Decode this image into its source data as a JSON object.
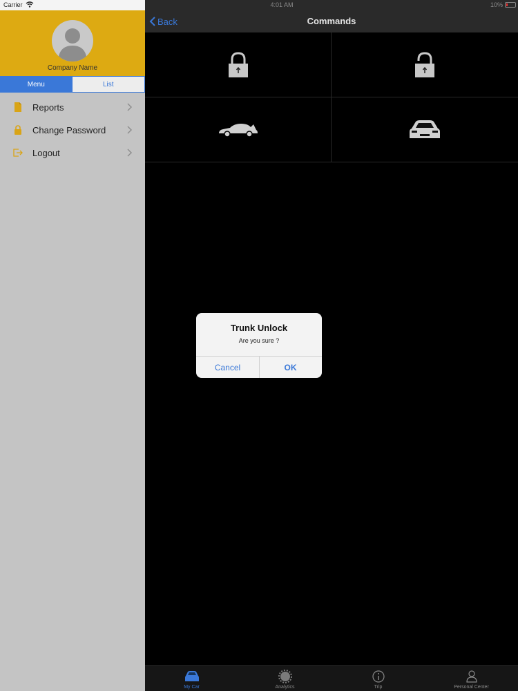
{
  "status": {
    "carrier": "Carrier",
    "time": "4:01 AM",
    "battery": "10%"
  },
  "sidebar": {
    "company_name": "Company Name",
    "tabs": [
      {
        "label": "Menu"
      },
      {
        "label": "List"
      }
    ],
    "items": [
      {
        "label": "Reports",
        "icon": "document-icon"
      },
      {
        "label": "Change Password",
        "icon": "lock-icon"
      },
      {
        "label": "Logout",
        "icon": "logout-icon"
      }
    ]
  },
  "navbar": {
    "back_label": "Back",
    "title": "Commands"
  },
  "commands": [
    {
      "icon": "lock-icon"
    },
    {
      "icon": "unlock-icon"
    },
    {
      "icon": "trunk-icon"
    },
    {
      "icon": "car-front-icon"
    }
  ],
  "alert": {
    "title": "Trunk Unlock",
    "message": "Are you sure ?",
    "cancel_label": "Cancel",
    "ok_label": "OK"
  },
  "tabbar": {
    "items": [
      {
        "label": "My Car",
        "icon": "car-icon"
      },
      {
        "label": "Analytics",
        "icon": "analytics-icon"
      },
      {
        "label": "Trip",
        "icon": "info-icon"
      },
      {
        "label": "Personal Center",
        "icon": "person-icon"
      }
    ]
  },
  "colors": {
    "accent": "#3a78d8",
    "profile_bg": "#ddaa12",
    "sidebar_bg": "#c4c4c4"
  }
}
